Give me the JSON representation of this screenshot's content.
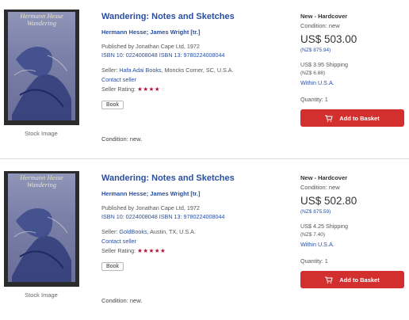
{
  "listings": [
    {
      "cover_title": "Hermann Hesse Wandering",
      "stock_label": "Stock Image",
      "title": "Wandering: Notes and Sketches",
      "author": "Hermann Hesse; James Wright [tr.]",
      "published": "Published by Jonathan Cape Ltd, 1972",
      "isbn": "ISBN 10: 0224008048  ISBN 13: 9780224008044",
      "seller_prefix": "Seller: ",
      "seller_name": "Hafa Adai Books",
      "seller_location": ", Moncks Corner, SC, U.S.A.",
      "contact": "Contact seller",
      "rating_label": "Seller Rating: ",
      "rating": 4,
      "rating_on": "★★★★",
      "rating_off": "☆",
      "badge": "Book",
      "condition_note": "Condition: new.",
      "binding": "New - Hardcover",
      "condition": "Condition: new",
      "price": "US$ 503.00",
      "price_nzd": "(NZ$ 875.94)",
      "shipping": "US$ 3.95 Shipping",
      "shipping_nzd": "(NZ$ 6.88)",
      "within": "Within U.S.A.",
      "quantity": "Quantity: 1",
      "basket": "Add to Basket"
    },
    {
      "cover_title": "Hermann Hesse Wandering",
      "stock_label": "Stock Image",
      "title": "Wandering: Notes and Sketches",
      "author": "Hermann Hesse; James Wright [tr.]",
      "published": "Published by Jonathan Cape Ltd, 1972",
      "isbn": "ISBN 10: 0224008048  ISBN 13: 9780224008044",
      "seller_prefix": "Seller: ",
      "seller_name": "GoldBooks",
      "seller_location": ", Austin, TX, U.S.A.",
      "contact": "Contact seller",
      "rating_label": "Seller Rating: ",
      "rating": 5,
      "rating_on": "★★★★★",
      "rating_off": "",
      "badge": "Book",
      "condition_note": "Condition: new.",
      "binding": "New - Hardcover",
      "condition": "Condition: new",
      "price": "US$ 502.80",
      "price_nzd": "(NZ$ 875.59)",
      "shipping": "US$ 4.25 Shipping",
      "shipping_nzd": "(NZ$ 7.40)",
      "within": "Within U.S.A.",
      "quantity": "Quantity: 1",
      "basket": "Add to Basket"
    }
  ],
  "colors": {
    "link": "#2a4f9e",
    "star": "#b0123d",
    "basket": "#d32f2f"
  }
}
